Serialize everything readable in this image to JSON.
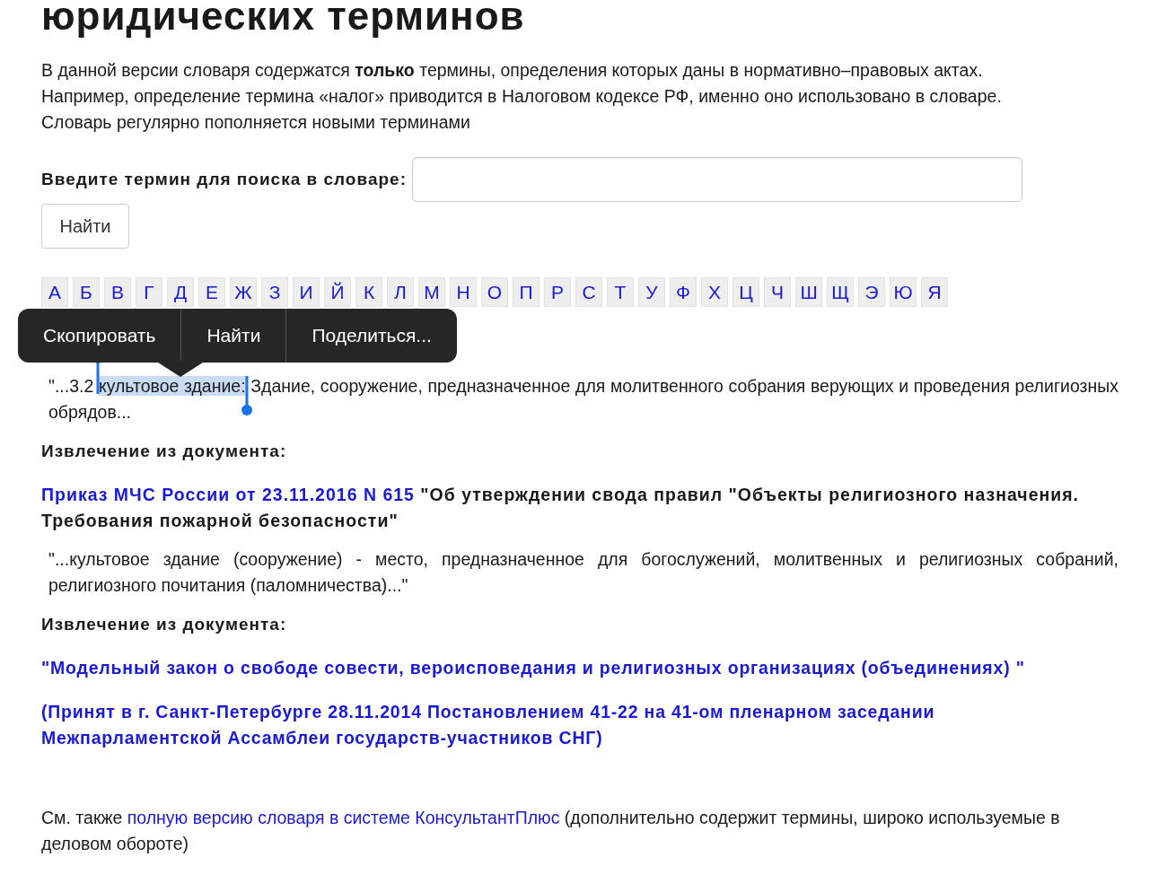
{
  "title": "юридических терминов",
  "intro": [
    "В данной версии словаря содержатся **только** термины, определения которых даны в нормативно–правовых актах.",
    "Например, определение термина «налог» приводится в Налоговом кодексе РФ, именно оно использовано в словаре.",
    "Словарь регулярно пополняется новыми терминами"
  ],
  "search": {
    "label": "Введите термин для поиска в словаре:",
    "button": "Найти"
  },
  "alphabet": [
    "А",
    "Б",
    "В",
    "Г",
    "Д",
    "Е",
    "Ж",
    "З",
    "И",
    "Й",
    "К",
    "Л",
    "М",
    "Н",
    "О",
    "П",
    "Р",
    "С",
    "Т",
    "У",
    "Ф",
    "Х",
    "Ц",
    "Ч",
    "Ш",
    "Щ",
    "Э",
    "Ю",
    "Я"
  ],
  "context_menu": [
    "Скопировать",
    "Найти",
    "Поделиться..."
  ],
  "entries": [
    {
      "kind": "quote",
      "before": "\"...3.2 ",
      "selected": "культовое здание:",
      "after": " Здание, сооружение, предназначенное для молитвенного собрания верующих и проведения религиозных обрядов..."
    },
    {
      "kind": "heading",
      "text": "Извлечение из документа:"
    },
    {
      "kind": "source",
      "link": "Приказ МЧС России от 23.11.2016 N 615",
      "text": "\"Об утверждении свода правил \"Объекты религиозного назначения. Требования пожарной безопасности\""
    },
    {
      "kind": "quote",
      "before": "\"...культовое здание (сооружение) - место, предназначенное для богослужений, молитвенных и религиозных собраний, религиозного почитания (паломничества)...\""
    },
    {
      "kind": "heading",
      "text": "Извлечение из документа:"
    },
    {
      "kind": "bluelink",
      "text": "\"Модельный закон о свободе совести, вероисповедания и религиозных организациях (объединениях) \""
    },
    {
      "kind": "bluelink",
      "text": "(Принят в г. Санкт-Петербурге 28.11.2014 Постановлением 41-22 на 41-ом пленарном заседании Межпарламентской Ассамблеи государств-участников СНГ)"
    }
  ],
  "footer": {
    "before": "См. также ",
    "link": "полную версию словаря в системе КонсультантПлюс",
    "after": " (дополнительно содержит термины, широко используемые в деловом обороте)"
  }
}
